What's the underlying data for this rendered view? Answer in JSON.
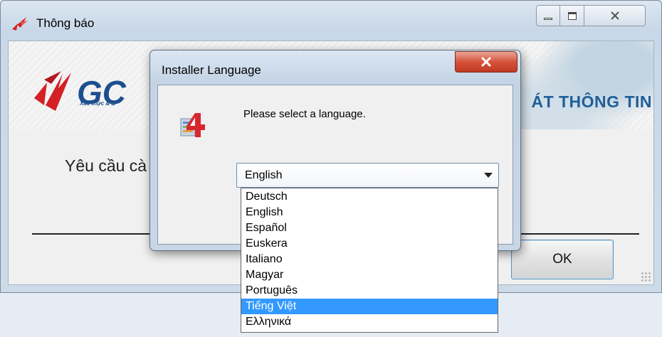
{
  "main_window": {
    "title": "Thông báo",
    "banner_title": "ÁT THÔNG TIN",
    "banner_tagline": "Xác thực & B",
    "prompt": "Yêu cầu cà",
    "ok_label": "OK"
  },
  "installer_dialog": {
    "title": "Installer Language",
    "message": "Please select a language.",
    "selected_language": "English",
    "options": [
      "Deutsch",
      "English",
      "Español",
      "Euskera",
      "Italiano",
      "Magyar",
      "Português",
      "Tiếng Việt",
      "Ελληνικά"
    ],
    "highlighted_option": "Tiếng Việt"
  },
  "colors": {
    "highlight": "#3399ff",
    "close_button": "#c13a22",
    "banner_blue": "#1f5f98",
    "logo_red": "#d42027"
  }
}
